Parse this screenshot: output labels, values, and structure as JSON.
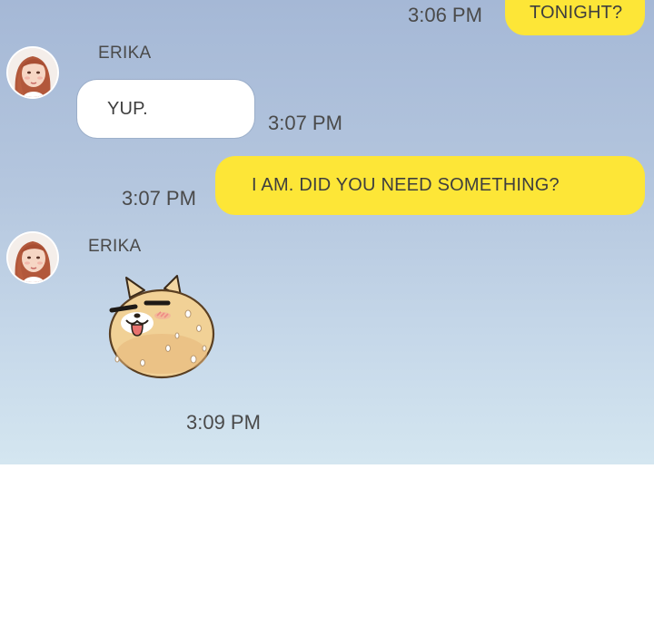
{
  "conversation": {
    "messages": [
      {
        "sender": "me",
        "text": "TONIGHT?",
        "time": "3:06 PM"
      },
      {
        "sender": "ERIKA",
        "text": "YUP.",
        "time": "3:07 PM"
      },
      {
        "sender": "me",
        "text": "I AM. DID YOU NEED SOMETHING?",
        "time": "3:07 PM"
      },
      {
        "sender": "ERIKA",
        "sticker": "blushing-bun-sticker",
        "time": "3:09 PM"
      }
    ]
  },
  "colors": {
    "my_bubble": "#fde637",
    "their_bubble": "#ffffff",
    "chat_bg_top": "#a5b8d6",
    "chat_bg_bottom": "#d4e6f0"
  },
  "icons": {
    "avatar": "erika-avatar-icon",
    "sticker": "blushing-bun-sticker"
  }
}
